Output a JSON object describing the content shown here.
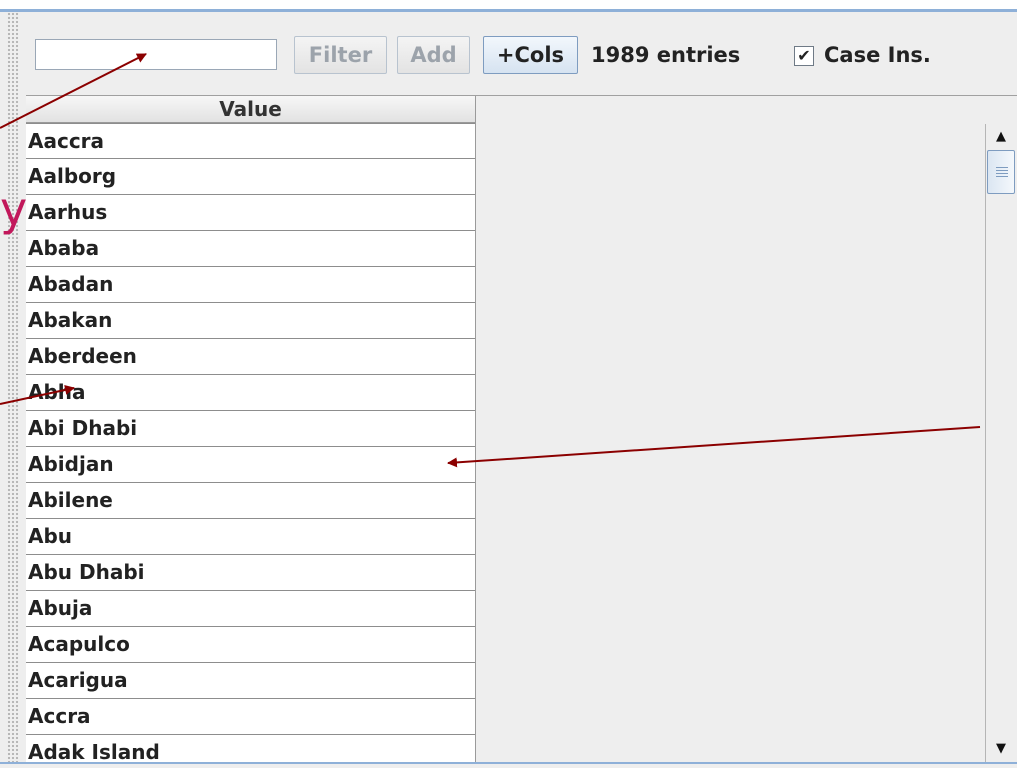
{
  "toolbar": {
    "filter_input_value": "",
    "filter_button": "Filter",
    "add_button": "Add",
    "cols_button": "+Cols",
    "entries_text": "1989 entries",
    "case_checkbox_checked": true,
    "case_label": "Case Ins."
  },
  "table": {
    "column_header": "Value",
    "rows": [
      "Aaccra",
      "Aalborg",
      "Aarhus",
      "Ababa",
      "Abadan",
      "Abakan",
      "Aberdeen",
      "Abha",
      "Abi Dhabi",
      "Abidjan",
      "Abilene",
      "Abu",
      "Abu Dhabi",
      "Abuja",
      "Acapulco",
      "Acarigua",
      "Accra",
      "Adak Island"
    ]
  },
  "scrollbar": {
    "up_icon": "up-arrow-icon",
    "down_icon": "down-arrow-icon"
  },
  "annotation": {
    "color": "#8b0000",
    "label_fragment": "y"
  }
}
